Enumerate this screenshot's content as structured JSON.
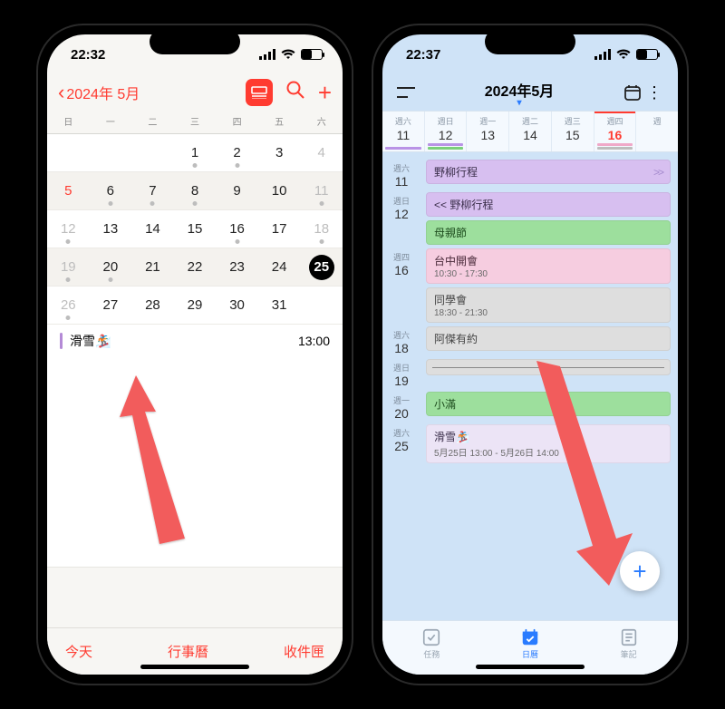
{
  "left": {
    "status_time": "22:32",
    "back_label": "2024年 5月",
    "weekdays": [
      "日",
      "一",
      "二",
      "三",
      "四",
      "五",
      "六"
    ],
    "grid": [
      [
        {
          "n": ""
        },
        {
          "n": ""
        },
        {
          "n": ""
        },
        {
          "n": "1",
          "dot": true
        },
        {
          "n": "2",
          "dot": true
        },
        {
          "n": "3"
        },
        {
          "n": "4",
          "grey": true
        }
      ],
      [
        {
          "n": "5",
          "sun": true
        },
        {
          "n": "6",
          "dot": true
        },
        {
          "n": "7",
          "dot": true
        },
        {
          "n": "8",
          "dot": true
        },
        {
          "n": "9"
        },
        {
          "n": "10"
        },
        {
          "n": "11",
          "grey": true,
          "dot": true
        }
      ],
      [
        {
          "n": "12",
          "grey": true,
          "dot": true
        },
        {
          "n": "13"
        },
        {
          "n": "14"
        },
        {
          "n": "15"
        },
        {
          "n": "16",
          "dot": true
        },
        {
          "n": "17"
        },
        {
          "n": "18",
          "grey": true,
          "dot": true
        }
      ],
      [
        {
          "n": "19",
          "grey": true,
          "dot": true
        },
        {
          "n": "20",
          "dot": true
        },
        {
          "n": "21"
        },
        {
          "n": "22"
        },
        {
          "n": "23"
        },
        {
          "n": "24"
        },
        {
          "n": "25",
          "sel": true
        }
      ],
      [
        {
          "n": "26",
          "grey": true,
          "dot": true
        },
        {
          "n": "27"
        },
        {
          "n": "28"
        },
        {
          "n": "29"
        },
        {
          "n": "30"
        },
        {
          "n": "31"
        },
        {
          "n": ""
        }
      ]
    ],
    "dim_rows": [
      1,
      3
    ],
    "event": {
      "title": "滑雪🏂",
      "time": "13:00"
    },
    "footer": {
      "today": "今天",
      "calendars": "行事曆",
      "inbox": "收件匣"
    }
  },
  "right": {
    "status_time": "22:37",
    "title": "2024年5月",
    "week_strip": [
      {
        "wd": "週六",
        "dn": "11",
        "bars": [
          "bp"
        ]
      },
      {
        "wd": "週日",
        "dn": "12",
        "bars": [
          "bp",
          "bg"
        ]
      },
      {
        "wd": "週一",
        "dn": "13"
      },
      {
        "wd": "週二",
        "dn": "14"
      },
      {
        "wd": "週三",
        "dn": "15"
      },
      {
        "wd": "週四",
        "dn": "16",
        "today": true,
        "bars": [
          "bpk",
          "bgr"
        ]
      },
      {
        "wd": "週",
        "dn": ""
      }
    ],
    "agenda": [
      {
        "wd": "週六",
        "dn": "11",
        "events": [
          {
            "cls": "purple",
            "title": "野柳行程",
            "chev": ">>"
          }
        ]
      },
      {
        "wd": "週日",
        "dn": "12",
        "events": [
          {
            "cls": "purple",
            "title": "<< 野柳行程"
          },
          {
            "cls": "green",
            "title": "母親節"
          }
        ]
      },
      {
        "wd": "週四",
        "dn": "16",
        "events": [
          {
            "cls": "pink",
            "title": "台中開會",
            "sub": "10:30 - 17:30"
          },
          {
            "cls": "grey",
            "title": "同學會",
            "sub": "18:30 - 21:30"
          }
        ]
      },
      {
        "wd": "週六",
        "dn": "18",
        "events": [
          {
            "cls": "grey",
            "title": "阿傑有約"
          }
        ]
      },
      {
        "wd": "週日",
        "dn": "19",
        "events": [
          {
            "cls": "scratch",
            "title": ""
          }
        ]
      },
      {
        "wd": "週一",
        "dn": "20",
        "events": [
          {
            "cls": "green",
            "title": "小滿"
          }
        ]
      },
      {
        "wd": "週六",
        "dn": "25",
        "events": [
          {
            "cls": "lav",
            "title": "滑雪🏂",
            "sub": "5月25日 13:00 - 5月26日 14:00"
          }
        ]
      }
    ],
    "tabs": {
      "tasks": "任務",
      "calendar": "日曆",
      "notes": "筆記"
    }
  }
}
